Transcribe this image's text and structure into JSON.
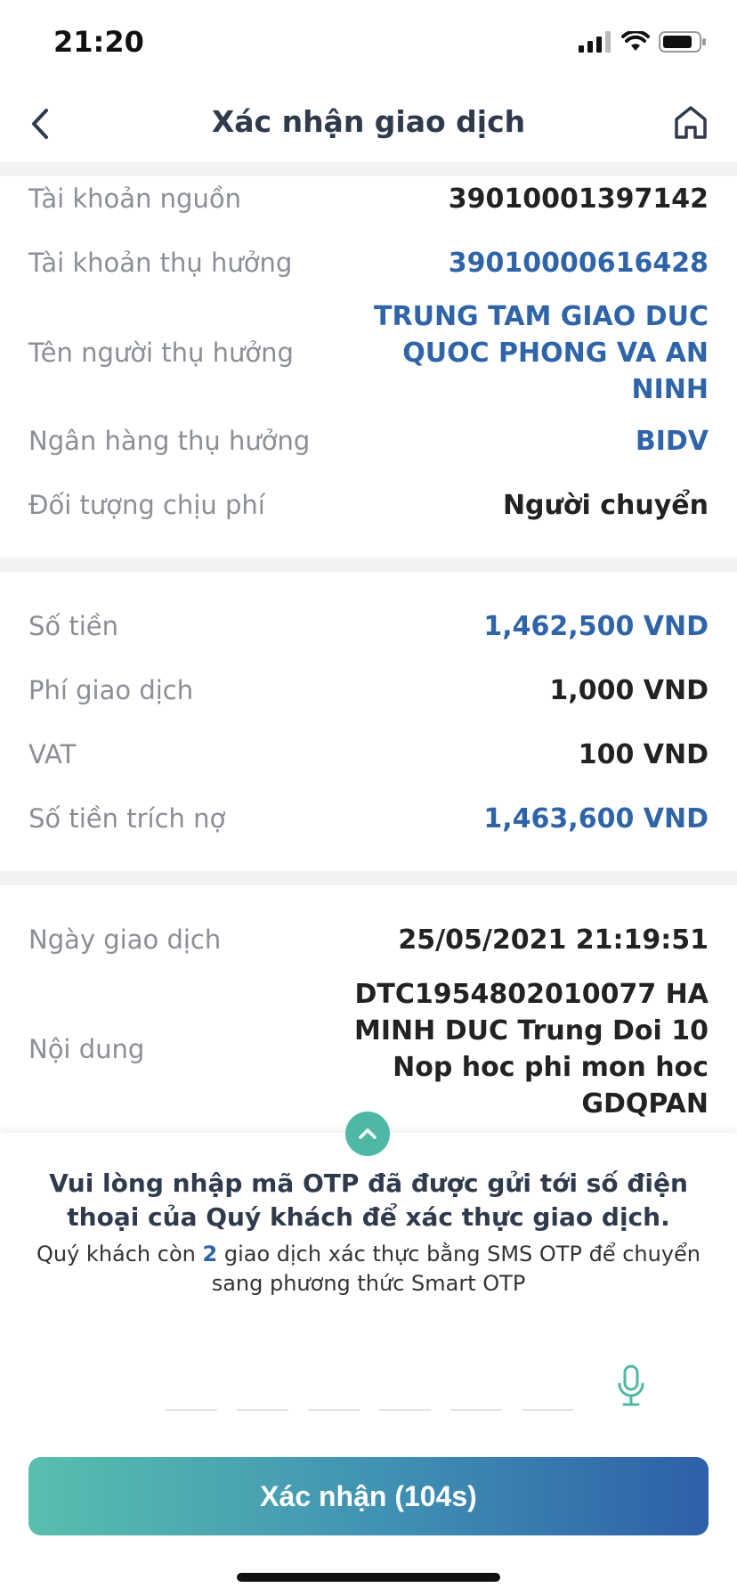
{
  "status": {
    "time": "21:20"
  },
  "header": {
    "title": "Xác nhận giao dịch"
  },
  "accounts": [
    {
      "label": "Tài khoản nguồn",
      "value": "39010001397142"
    },
    {
      "label": "Tài khoản thụ hưởng",
      "value": "39010000616428"
    },
    {
      "label": "Tên người thụ hưởng",
      "value": "TRUNG TAM GIAO DUC QUOC PHONG VA AN NINH"
    },
    {
      "label": "Ngân hàng thụ hưởng",
      "value": "BIDV"
    },
    {
      "label": "Đối tượng chịu phí",
      "value": "Người chuyển"
    }
  ],
  "amounts": [
    {
      "label": "Số tiền",
      "value": "1,462,500 VND"
    },
    {
      "label": "Phí giao dịch",
      "value": "1,000 VND"
    },
    {
      "label": "VAT",
      "value": "100 VND"
    },
    {
      "label": "Số tiền trích nợ",
      "value": "1,463,600 VND"
    }
  ],
  "details": [
    {
      "label": "Ngày giao dịch",
      "value": "25/05/2021 21:19:51"
    },
    {
      "label": "Nội dung",
      "value": "DTC1954802010077 HA MINH DUC Trung Doi 10 Nop hoc phi mon hoc GDQPAN"
    }
  ],
  "otp": {
    "title": "Vui lòng nhập mã OTP đã được gửi tới số điện thoại của Quý khách để xác thực giao dịch.",
    "note_prefix": "Quý khách còn",
    "note_count": "2",
    "note_suffix": "giao dịch xác thực bằng SMS OTP để chuyển sang phương thức Smart OTP",
    "digits": [
      "",
      "",
      "",
      "",
      "",
      ""
    ]
  },
  "confirm_button": {
    "label": "Xác nhận (104s)"
  },
  "colors": {
    "accent_blue": "#2f64a8",
    "teal": "#4fb8a4"
  }
}
